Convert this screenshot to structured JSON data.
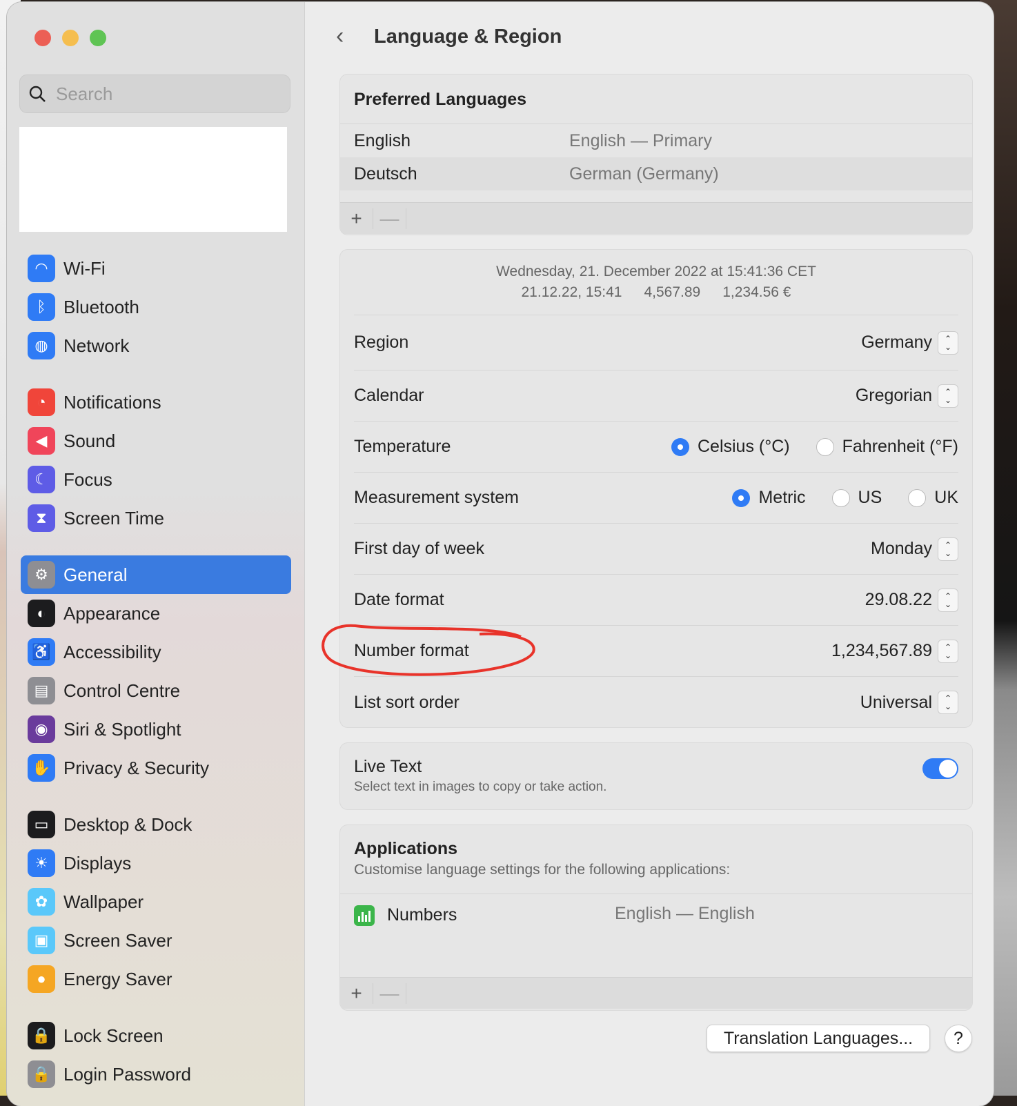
{
  "window": {
    "title": "Language & Region"
  },
  "sidebar": {
    "search_placeholder": "Search",
    "groups": [
      [
        {
          "label": "Wi-Fi",
          "icon": "wifi-icon",
          "color": "#2f7bf5"
        },
        {
          "label": "Bluetooth",
          "icon": "bluetooth-icon",
          "color": "#2f7bf5"
        },
        {
          "label": "Network",
          "icon": "globe-icon",
          "color": "#2f7bf5"
        }
      ],
      [
        {
          "label": "Notifications",
          "icon": "bell-icon",
          "color": "#f0453a"
        },
        {
          "label": "Sound",
          "icon": "speaker-icon",
          "color": "#f0455a"
        },
        {
          "label": "Focus",
          "icon": "moon-icon",
          "color": "#5e5ce6"
        },
        {
          "label": "Screen Time",
          "icon": "hourglass-icon",
          "color": "#5e5ce6"
        }
      ],
      [
        {
          "label": "General",
          "icon": "gear-icon",
          "color": "#8e8e93",
          "selected": true
        },
        {
          "label": "Appearance",
          "icon": "appearance-icon",
          "color": "#1c1c1e"
        },
        {
          "label": "Accessibility",
          "icon": "accessibility-icon",
          "color": "#2f7bf5"
        },
        {
          "label": "Control Centre",
          "icon": "control-centre-icon",
          "color": "#8e8e93"
        },
        {
          "label": "Siri & Spotlight",
          "icon": "siri-icon",
          "color": "#6a3b9c"
        },
        {
          "label": "Privacy & Security",
          "icon": "hand-icon",
          "color": "#2f7bf5"
        }
      ],
      [
        {
          "label": "Desktop & Dock",
          "icon": "dock-icon",
          "color": "#1c1c1e"
        },
        {
          "label": "Displays",
          "icon": "sun-icon",
          "color": "#2f7bf5"
        },
        {
          "label": "Wallpaper",
          "icon": "flower-icon",
          "color": "#5ac8fa"
        },
        {
          "label": "Screen Saver",
          "icon": "screen-saver-icon",
          "color": "#5ac8fa"
        },
        {
          "label": "Energy Saver",
          "icon": "bulb-icon",
          "color": "#f5a623"
        }
      ],
      [
        {
          "label": "Lock Screen",
          "icon": "lock-icon",
          "color": "#1c1c1e"
        },
        {
          "label": "Login Password",
          "icon": "lock-icon",
          "color": "#8e8e93"
        }
      ]
    ]
  },
  "preferred": {
    "title": "Preferred Languages",
    "languages": [
      {
        "name": "English",
        "detail": "English — Primary"
      },
      {
        "name": "Deutsch",
        "detail": "German (Germany)"
      }
    ],
    "add": "+",
    "remove": "—"
  },
  "preview": {
    "line1": "Wednesday, 21. December 2022 at 15:41:36 CET",
    "date": "21.12.22, 15:41",
    "number": "4,567.89",
    "currency": "1,234.56 €"
  },
  "settings": {
    "region": {
      "label": "Region",
      "value": "Germany"
    },
    "calendar": {
      "label": "Calendar",
      "value": "Gregorian"
    },
    "temperature": {
      "label": "Temperature",
      "options": [
        "Celsius (°C)",
        "Fahrenheit (°F)"
      ],
      "selected": "Celsius (°C)"
    },
    "measurement": {
      "label": "Measurement system",
      "options": [
        "Metric",
        "US",
        "UK"
      ],
      "selected": "Metric"
    },
    "first_day": {
      "label": "First day of week",
      "value": "Monday"
    },
    "date_format": {
      "label": "Date format",
      "value": "29.08.22"
    },
    "number_format": {
      "label": "Number format",
      "value": "1,234,567.89"
    },
    "sort_order": {
      "label": "List sort order",
      "value": "Universal"
    }
  },
  "live_text": {
    "title": "Live Text",
    "subtitle": "Select text in images to copy or take action.",
    "enabled": true
  },
  "applications": {
    "title": "Applications",
    "subtitle": "Customise language settings for the following applications:",
    "apps": [
      {
        "name": "Numbers",
        "language": "English — English"
      }
    ],
    "add": "+",
    "remove": "—"
  },
  "buttons": {
    "translation": "Translation Languages...",
    "help": "?"
  },
  "annotation_color": "#e8332a"
}
